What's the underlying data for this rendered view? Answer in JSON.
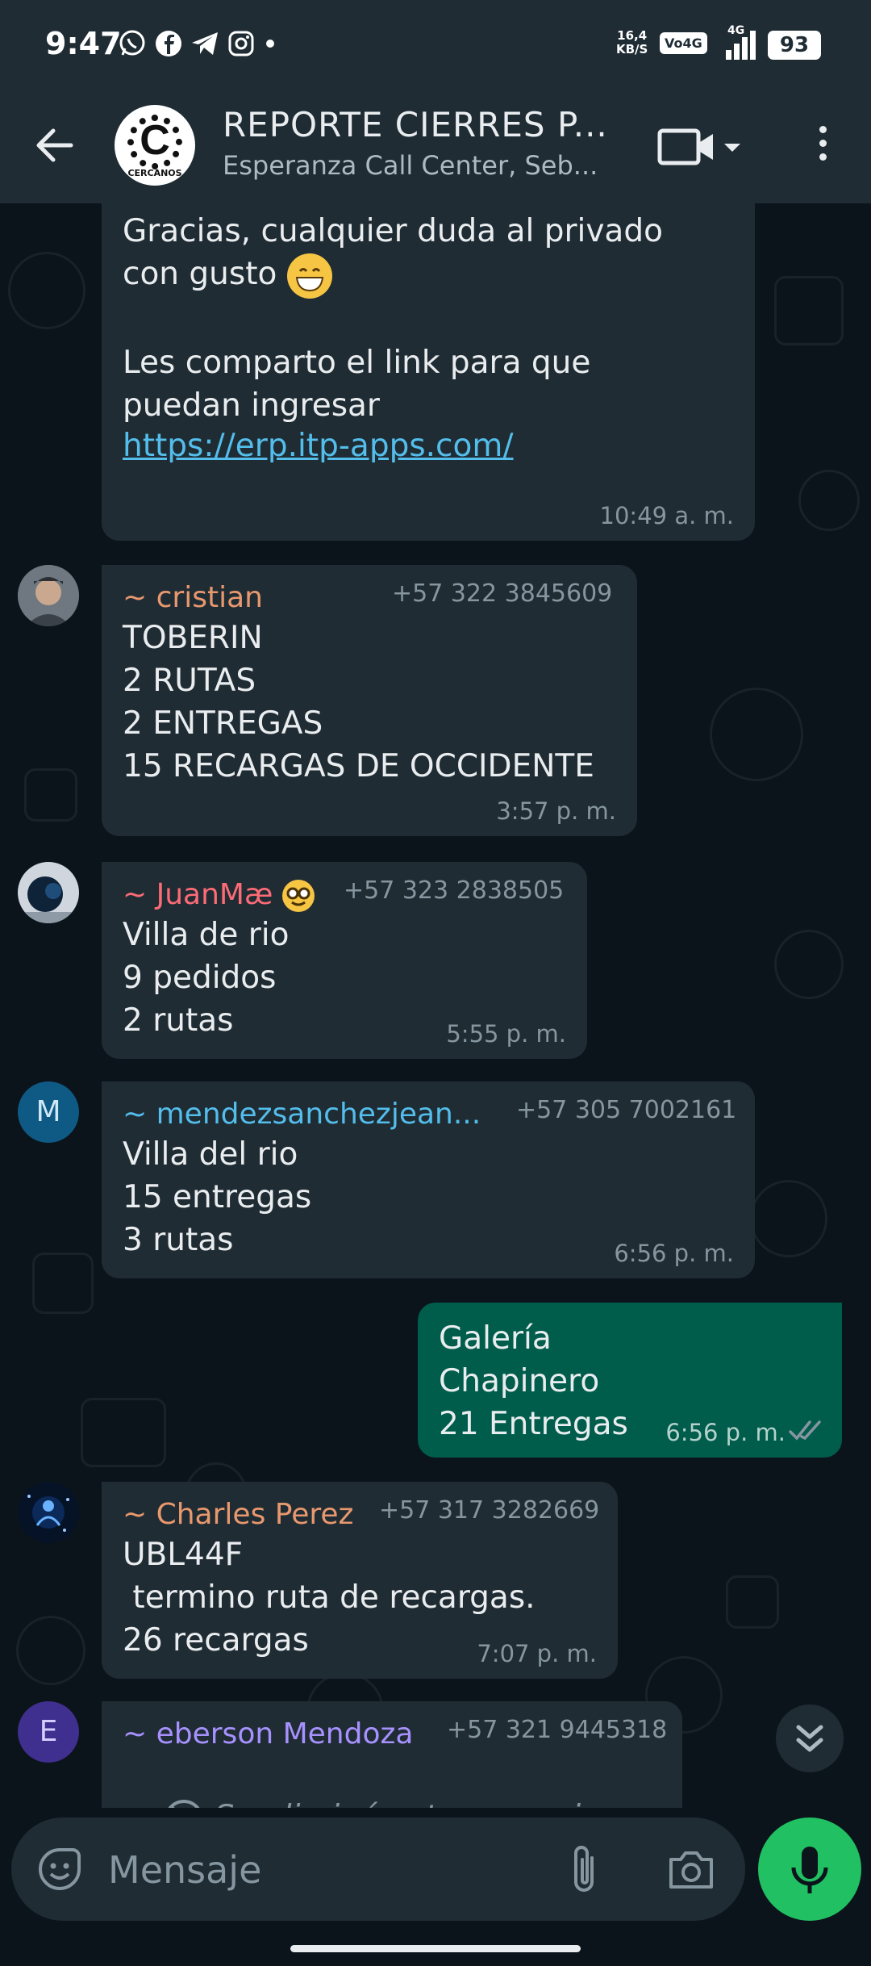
{
  "status_bar": {
    "time": "9:47",
    "net_speed_value": "16,4",
    "net_speed_unit": "KB/S",
    "volte": "Vo4G",
    "signal_label": "4G",
    "battery": "93"
  },
  "header": {
    "group_name": "REPORTE CIERRES P...",
    "subtitle": "Esperanza Call Center, Seb...",
    "avatar_text": "CERCANOS"
  },
  "messages": [
    {
      "id": "m1",
      "direction": "in",
      "lines": [
        "Gracias, cualquier duda al privado",
        "con gusto",
        "",
        "Les comparto el link para que",
        "puedan ingresar",
        ""
      ],
      "link": "https://erp.itp-apps.com/",
      "time": "10:49 a. m."
    },
    {
      "id": "m2",
      "direction": "in",
      "sender": "~ cristian",
      "sender_color": "#e8986e",
      "phone": "+57 322 3845609",
      "text": "TOBERIN\n2 RUTAS\n2 ENTREGAS\n15 RECARGAS DE OCCIDENTE",
      "time": "3:57 p. m."
    },
    {
      "id": "m3",
      "direction": "in",
      "sender": "~ JuanMæ",
      "sender_color": "#fc6b76",
      "phone": "+57 323 2838505",
      "text": "Villa de rio\n9 pedidos\n2 rutas",
      "time": "5:55 p. m."
    },
    {
      "id": "m4",
      "direction": "in",
      "sender": "~ mendezsanchezjean...",
      "sender_color": "#53bdeb",
      "phone": "+57 305 7002161",
      "avatar_letter": "M",
      "text": "Villa del rio\n15 entregas\n3 rutas",
      "time": "6:56 p. m."
    },
    {
      "id": "m5",
      "direction": "out",
      "text": "Galería\nChapinero\n21 Entregas",
      "time": "6:56 p. m."
    },
    {
      "id": "m6",
      "direction": "in",
      "sender": "~ Charles Perez",
      "sender_color": "#e8986e",
      "phone": "+57 317 3282669",
      "text": "UBL44F\n termino ruta de recargas.\n26 recargas",
      "time": "7:07 p. m."
    },
    {
      "id": "m7",
      "direction": "in",
      "sender": "~ eberson Mendoza",
      "sender_color": "#a791ff",
      "phone": "+57 321 9445318",
      "avatar_letter": "E",
      "text": "Se eliminó este mensaje."
    }
  ],
  "composer": {
    "placeholder": "Mensaje"
  },
  "colors": {
    "background": "#0b141a",
    "bar": "#1f2c34",
    "incoming_bubble": "#202c33",
    "outgoing_bubble": "#005c4b",
    "accent_green": "#21c063",
    "link": "#53bdeb"
  },
  "icons": [
    "back-arrow-icon",
    "video-call-icon",
    "dropdown-caret-icon",
    "more-options-icon",
    "whatsapp-icon",
    "facebook-icon",
    "telegram-icon",
    "instagram-icon",
    "read-receipt-icon",
    "deleted-icon",
    "scroll-down-icon",
    "emoji-icon",
    "attach-icon",
    "camera-icon",
    "microphone-icon"
  ]
}
